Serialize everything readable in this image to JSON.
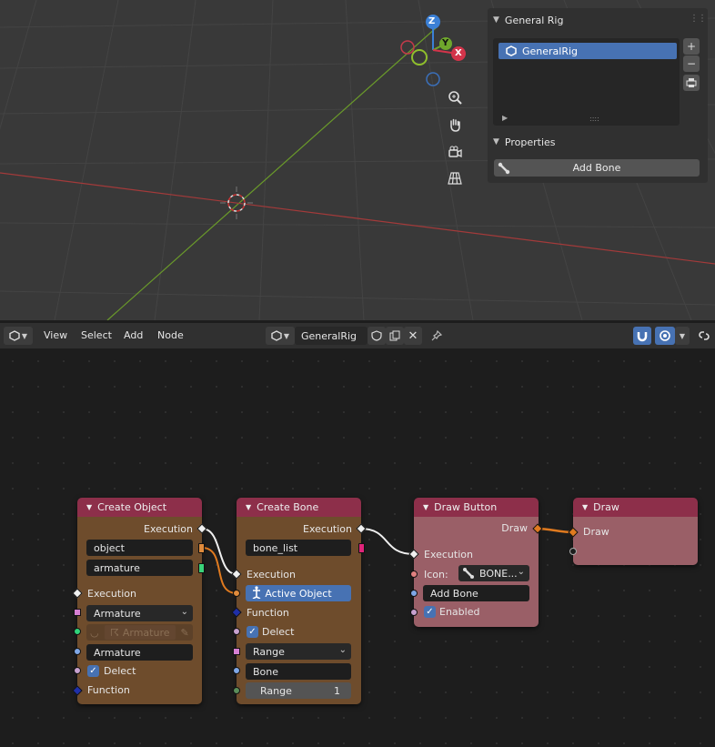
{
  "viewport": {
    "gizmo": {
      "z": "Z",
      "y": "Y",
      "x": "X"
    },
    "tools": [
      "zoom-icon",
      "hand-icon",
      "camera-icon",
      "perspective-grid-icon"
    ]
  },
  "npanel": {
    "title": "General Rig",
    "list_item": "GeneralRig",
    "properties_title": "Properties",
    "add_bone": "Add Bone"
  },
  "header": {
    "menu": [
      "View",
      "Select",
      "Add",
      "Node"
    ],
    "tree_name": "GeneralRig"
  },
  "nodes": {
    "create_object": {
      "title": "Create Object",
      "execution_out": "Execution",
      "field_object": "object",
      "field_armature": "armature",
      "execution_in": "Execution",
      "type_select": "Armature",
      "data_placeholder": "Armature",
      "name_field": "Armature",
      "delect": "Delect",
      "function": "Function"
    },
    "create_bone": {
      "title": "Create Bone",
      "execution_out": "Execution",
      "field_bone_list": "bone_list",
      "execution_in": "Execution",
      "active_object": "Active Object",
      "function": "Function",
      "delect": "Delect",
      "range_select": "Range",
      "bone_field": "Bone",
      "range_label": "Range",
      "range_value": "1"
    },
    "draw_button": {
      "title": "Draw Button",
      "draw_out": "Draw",
      "execution_in": "Execution",
      "icon_label": "Icon:",
      "icon_value": "BONE...",
      "text_field": "Add Bone",
      "enabled": "Enabled"
    },
    "draw": {
      "title": "Draw",
      "draw_in": "Draw"
    }
  },
  "colors": {
    "node_header": "#8d2f4a",
    "node_body_brown": "#6e4c2c",
    "node_body_pink": "#9a5f67",
    "accent_blue": "#4772b3",
    "link_orange": "#e07a1f"
  }
}
